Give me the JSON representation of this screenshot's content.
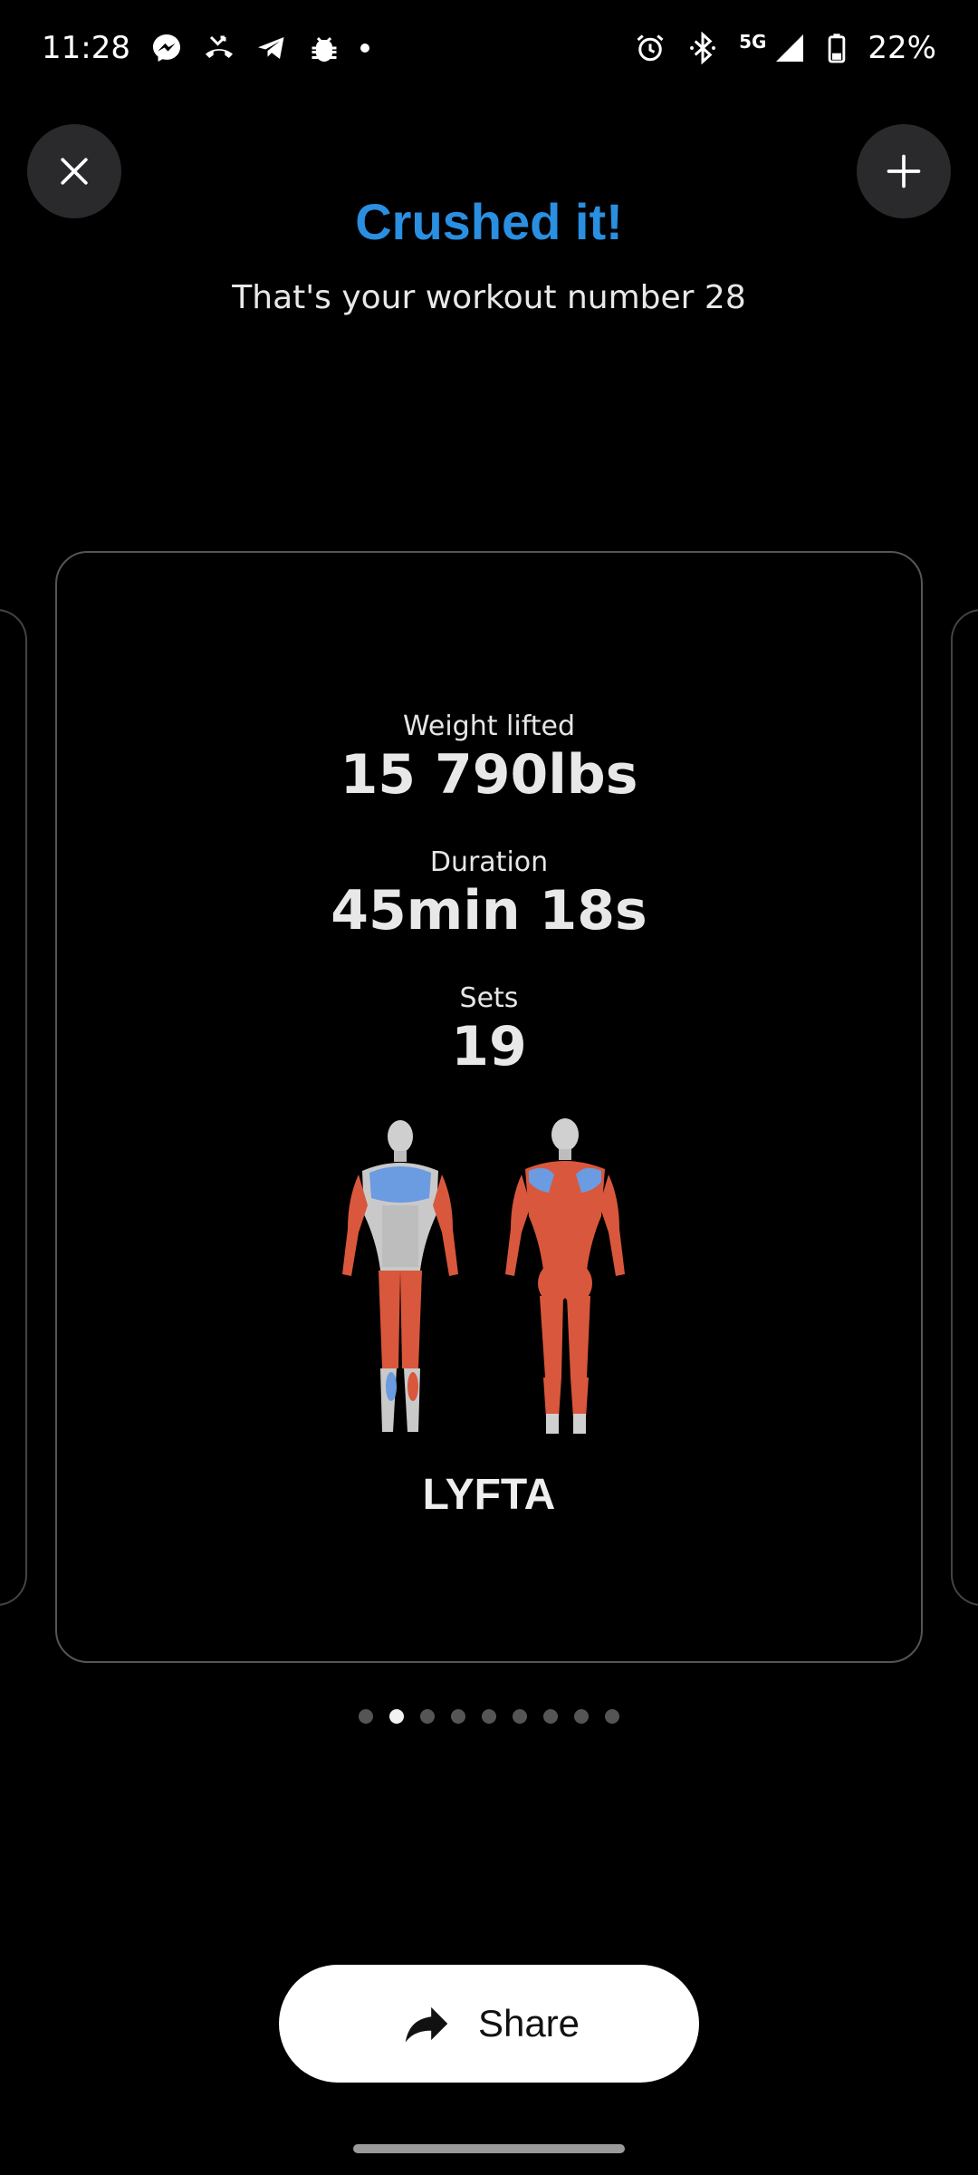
{
  "status_bar": {
    "time": "11:28",
    "network": "5G",
    "battery": "22%",
    "icons": [
      "messenger-icon",
      "missed-call-icon",
      "telegram-icon",
      "bug-icon",
      "dot-icon",
      "alarm-icon",
      "bluetooth-icon",
      "signal-icon",
      "battery-icon"
    ]
  },
  "header": {
    "title": "Crushed it!",
    "subtitle": "That's your workout number 28",
    "title_color": "#2a8fe0"
  },
  "card": {
    "stats": [
      {
        "label": "Weight lifted",
        "value": "15 790lbs"
      },
      {
        "label": "Duration",
        "value": "45min 18s"
      },
      {
        "label": "Sets",
        "value": "19"
      }
    ],
    "brand": "LYFTA",
    "muscle_colors": {
      "worked": "#d9573c",
      "highlight": "#6b9be0",
      "base": "#c9c9c9"
    }
  },
  "pagination": {
    "total": 9,
    "active_index": 1
  },
  "share_button": {
    "label": "Share"
  }
}
